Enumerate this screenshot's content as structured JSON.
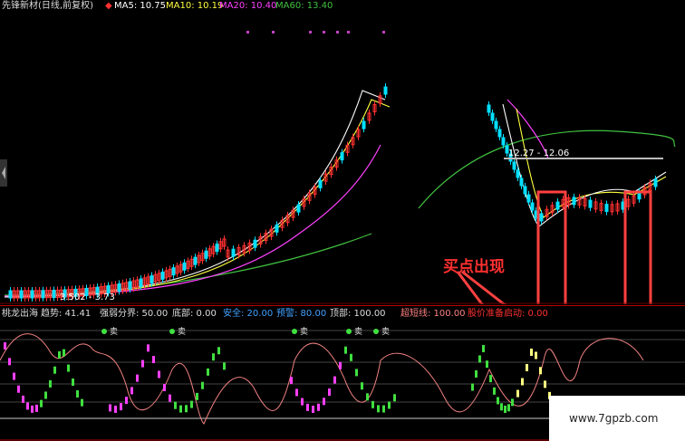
{
  "header": {
    "title": "先锋新材(日线,前复权)",
    "marker": "◆",
    "ma5": "MA5: 10.75",
    "ma10": "MA10: 10.19",
    "ma20": "MA20: 10.40",
    "ma60": "MA60: 13.40"
  },
  "price_labels": {
    "low_label": "3.502 - 3.73",
    "range_label": "12.27 - 12.06"
  },
  "indicator": {
    "name": "桃龙出海",
    "trend": "趋势: 41.41",
    "divide": "强弱分界: 50.00",
    "bottom": "底部: 0.00",
    "safe": "安全: 20.00",
    "warn": "预警: 80.00",
    "top": "顶部: 100.00",
    "overshort": "超短线: 100.00",
    "ready": "股价准备启动: 0.00"
  },
  "tags": {
    "sell": "卖"
  },
  "annotation": {
    "buy_point": "买点出现"
  },
  "watermark": {
    "site": "www.7gpzb.com"
  },
  "colors": {
    "up": "#ff3030",
    "down": "#00e0ff",
    "ma5": "#ffffff",
    "ma10": "#ffff40",
    "ma20": "#ff40ff",
    "ma60": "#40c040",
    "divider": "#b00000"
  }
}
